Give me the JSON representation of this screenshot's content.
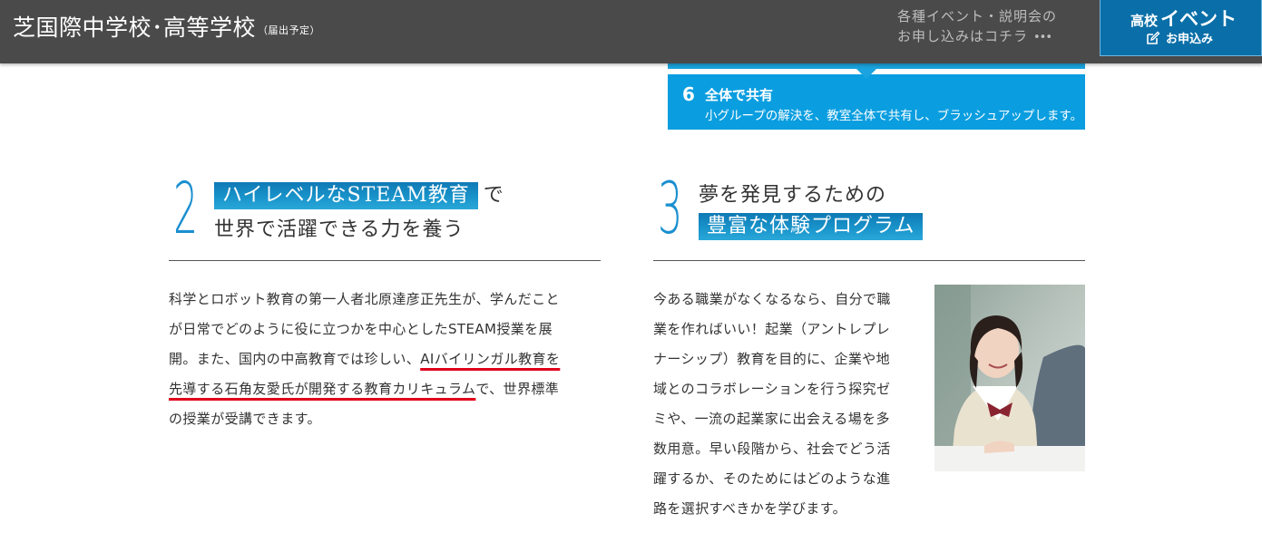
{
  "header": {
    "school_name": "芝国際中学校･高等学校",
    "school_note": "（届出予定）",
    "event_link_line1": "各種イベント・説明会の",
    "event_link_line2": "お申し込みはコチラ",
    "event_link_more": "•••",
    "event_button": {
      "label_small": "高校",
      "label_big": "イベント",
      "label_sub": "お申込み"
    }
  },
  "step6": {
    "number": "6",
    "title": "全体で共有",
    "description": "小グループの解決を、教室全体で共有し、ブラッシュアップします。"
  },
  "section2": {
    "number": "2",
    "heading_highlight": "ハイレベルなSTEAM教育",
    "heading_after": "で",
    "heading_line2": "世界で活躍できる力を養う",
    "body_lines": [
      "科学とロボット教育の第一人者北原達彦正先生が、学んだこと",
      "が日常でどのように役に立つかを中心としたSTEAM授業を展",
      "開。また、国内の中高教育では珍しい、",
      "AIバイリンガル教育を",
      "先導する石角友愛氏が開発する教育カリキュラム",
      "で、世界標準",
      "の授業が受講できます。"
    ]
  },
  "section3": {
    "number": "3",
    "heading_line1": "夢を発見するための",
    "heading_highlight": "豊富な体験プログラム",
    "body_lines": [
      "今ある職業がなくなるなら、自分で職",
      "業を作ればいい！起業（アントレプレ",
      "ナーシップ）教育を目的に、企業や地",
      "域とのコラボレーションを行う探究ゼ",
      "ミや、一流の起業家に出会える場を多",
      "数用意。早い段階から、社会でどう活",
      "躍するか、そのためにはどのような進",
      "路を選択すべきかを学びます。"
    ]
  },
  "colors": {
    "header_bg": "#4a4a4a",
    "accent_blue": "#0a9ee0",
    "number_blue": "#1a8fd0",
    "underline_red": "#e0001b"
  }
}
